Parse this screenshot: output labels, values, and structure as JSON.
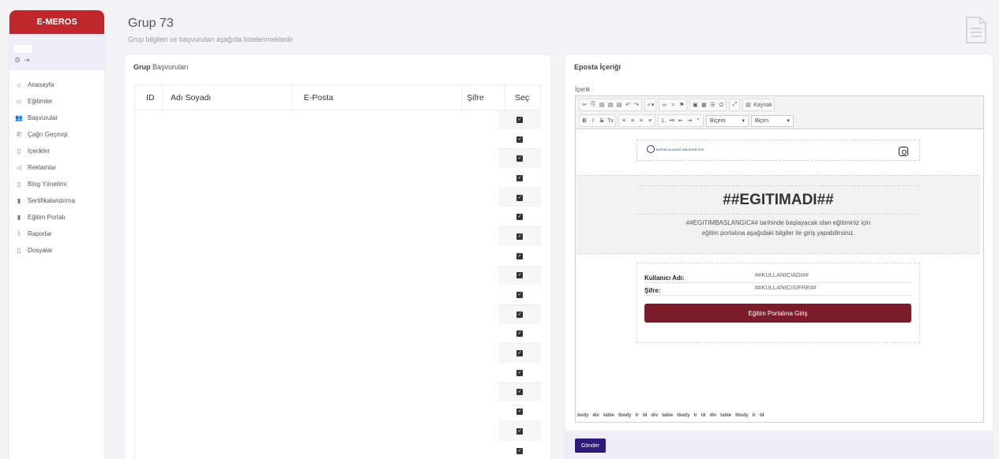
{
  "brand": "E-MEROS",
  "sidebar": {
    "items": [
      {
        "label": "Anasayfa",
        "icon": "home-icon"
      },
      {
        "label": "Eğitimler",
        "icon": "book-icon"
      },
      {
        "label": "Başvurular",
        "icon": "users-icon"
      },
      {
        "label": "Çağrı Geçmişi",
        "icon": "phone-icon"
      },
      {
        "label": "İçerikler",
        "icon": "file-icon"
      },
      {
        "label": "Reklamlar",
        "icon": "megaphone-icon"
      },
      {
        "label": "Blog Yönetimi",
        "icon": "file-icon"
      },
      {
        "label": "Sertifikalandırma",
        "icon": "file-solid-icon"
      },
      {
        "label": "Eğitim Portalı",
        "icon": "file-solid-icon"
      },
      {
        "label": "Raporlar",
        "icon": "chart-icon"
      },
      {
        "label": "Dosyalar",
        "icon": "file-icon"
      }
    ]
  },
  "header": {
    "title": "Grup 73",
    "subtitle": "Grup bilgileri ve başvuruları aşağıda listelenmektedir"
  },
  "left_card": {
    "title_bold": "Grup",
    "title_rest": " Başvuruları",
    "columns": [
      "ID",
      "Adı Soyadı",
      "E-Posta",
      "Şifre",
      "Seç"
    ],
    "row_count": 18
  },
  "right_card": {
    "title": "Eposta İçeriği",
    "field_label": "İçerik",
    "toolbar": {
      "source_label": "Kaynak",
      "format_label_1": "Biçem",
      "format_label_2": "Biçim"
    },
    "email": {
      "logo_text": "BURSA ULUDAĞ ÜNİVERSİTESİ",
      "title": "##EGITIMADI##",
      "text_line1": "##EGITIMBASLANGIC## tarihinde başlayacak olan eğitiminiz için",
      "text_line2": "eğitim portalına aşağıdaki bilgiler ile giriş yapabilirsiniz.",
      "user_label": "Kullanıcı Adı:",
      "user_value": "##KULLANICIADI##",
      "pass_label": "Şifre:",
      "pass_value": "##KULLANICISIFRE##",
      "button": "Eğitim Portalına Giriş"
    },
    "path": [
      "body",
      "div",
      "table",
      "tbody",
      "tr",
      "td",
      "div",
      "table",
      "tbody",
      "tr",
      "td",
      "div",
      "table",
      "tbody",
      "tr",
      "td"
    ],
    "send_button": "Gönder"
  },
  "colors": {
    "brand": "#c0272d",
    "send": "#2d1a7a",
    "email_button": "#7b1c2a"
  }
}
